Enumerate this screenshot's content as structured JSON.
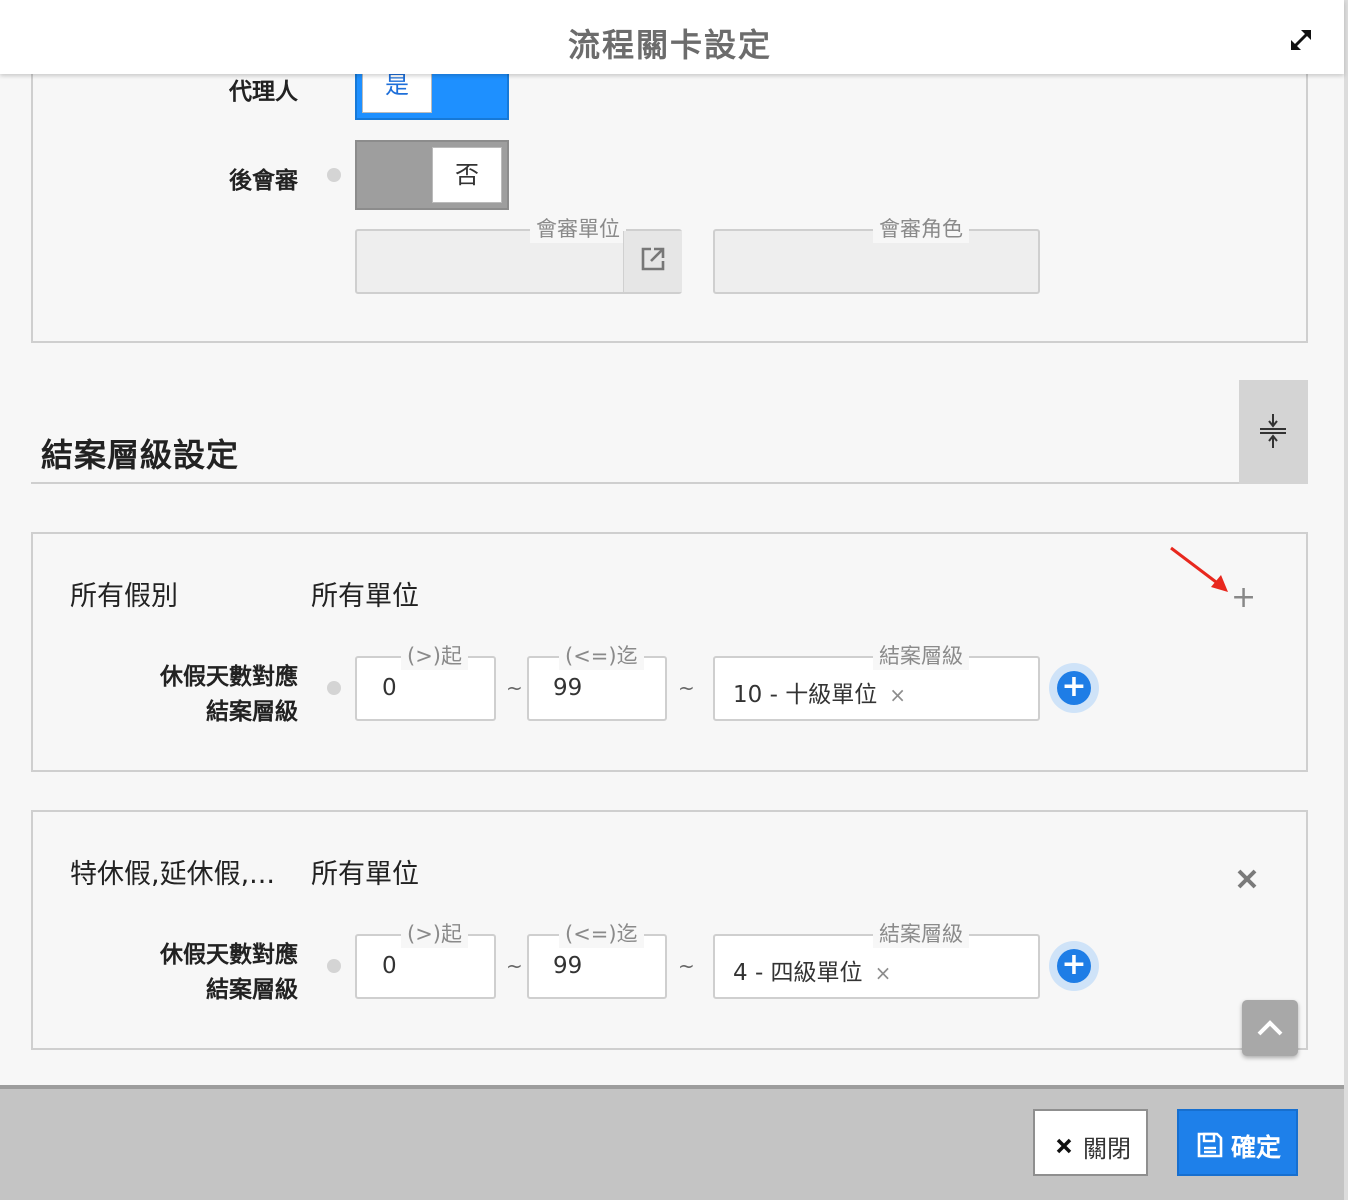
{
  "header": {
    "title": "流程關卡設定",
    "expand_icon": "expand-arrows-icon"
  },
  "top_panel": {
    "agent_label": "代理人",
    "agent_toggle_value": "是",
    "post_review_label": "後會審",
    "post_review_toggle_value": "否",
    "review_unit_legend": "會審單位",
    "review_unit_value": "",
    "review_role_legend": "會審角色",
    "review_role_value": ""
  },
  "section": {
    "title": "結案層級設定"
  },
  "rules": [
    {
      "leave_types": "所有假別",
      "units": "所有單位",
      "days_label_line1": "休假天數對應",
      "days_label_line2": "結案層級",
      "from_legend": "(>)起",
      "from_value": "0",
      "to_legend": "(<=)迄",
      "to_value": "99",
      "tilde": "~",
      "level_legend": "結案層級",
      "level_value": "10 - 十級單位",
      "clear": "×",
      "add_row": "+",
      "add_rule": "+"
    },
    {
      "leave_types": "特休假,延休假,...",
      "units": "所有單位",
      "days_label_line1": "休假天數對應",
      "days_label_line2": "結案層級",
      "from_legend": "(>)起",
      "from_value": "0",
      "to_legend": "(<=)迄",
      "to_value": "99",
      "tilde": "~",
      "level_legend": "結案層級",
      "level_value": "4 - 四級單位",
      "clear": "×",
      "add_row": "+"
    }
  ],
  "footer": {
    "close_label": "關閉",
    "confirm_label": "確定"
  },
  "colors": {
    "primary": "#1e80ea",
    "toggle_on": "#1e90ff",
    "annotation_arrow": "#e8281e"
  }
}
